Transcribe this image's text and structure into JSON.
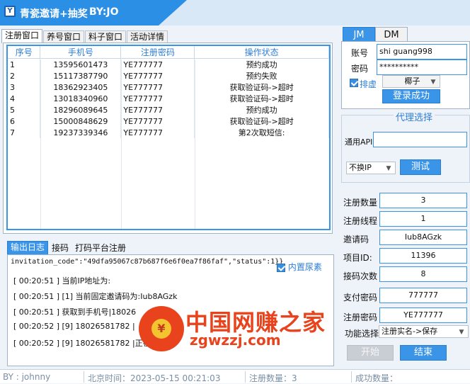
{
  "window": {
    "title": "青瓷邀请+抽奖",
    "subtitle": "BY:JO",
    "icon": "app-icon"
  },
  "main_tabs": [
    "注册窗口",
    "养号窗口",
    "料子窗口",
    "活动详情"
  ],
  "grid": {
    "headers": [
      "序号",
      "手机号",
      "注册密码",
      "操作状态"
    ],
    "rows": [
      [
        "1",
        "13595601473",
        "YE777777",
        "预约成功"
      ],
      [
        "2",
        "15117387790",
        "YE777777",
        "预约失败"
      ],
      [
        "3",
        "18362923405",
        "YE777777",
        "获取验证码->超时"
      ],
      [
        "4",
        "13018340960",
        "YE777777",
        "获取验证码->超时"
      ],
      [
        "5",
        "18296089645",
        "YE777777",
        "预约成功"
      ],
      [
        "6",
        "15000848629",
        "YE777777",
        "获取验证码->超时"
      ],
      [
        "7",
        "19237339346",
        "YE777777",
        "第2次取短信:"
      ]
    ]
  },
  "log_tabs": [
    "输出日志",
    "接码",
    "打码平台注册"
  ],
  "log": {
    "first_line": "invitation_code\":\"49dfa95067c87b687f6e6f0ea7f86faf\",\"status\":1}}",
    "builtin_checkbox": "内置尿素",
    "lines": [
      "[ 00:20:51 ] 当前IP地址为:",
      "[ 00:20:51 ] [1] 当前固定邀请码为:Iub8AGzk",
      "[ 00:20:51 ] 获取到手机号|18026",
      "[ 00:20:52 ] [9] 18026581782 |",
      "[ 00:20:52 ] [9] 18026581782 |正在"
    ]
  },
  "watermark": {
    "cn": "中国网赚之家",
    "url": "zgwzzj.com",
    "coin": "¥"
  },
  "right_tabs": [
    "JM",
    "DM"
  ],
  "account": {
    "user_label": "账号",
    "user_value": "shi guang998",
    "pass_label": "密码",
    "pass_value": "**********",
    "queue_label": "排虚",
    "queue_combo": "椰子",
    "login_button": "登录成功"
  },
  "proxy": {
    "group_title": "代理选择",
    "api_label": "通用API",
    "api_value": "",
    "ip_combo": "不换IP",
    "test_button": "测试"
  },
  "params": [
    {
      "label": "注册数量",
      "value": "3"
    },
    {
      "label": "注册线程",
      "value": "1"
    },
    {
      "label": "邀请码",
      "value": "Iub8AGzk"
    },
    {
      "label": "项目ID:",
      "value": "11396"
    },
    {
      "label": "接码次数",
      "value": "8"
    },
    {
      "label": "支付密码",
      "value": "777777"
    },
    {
      "label": "注册密码",
      "value": "YE777777"
    }
  ],
  "function_select": {
    "label": "功能选择",
    "value": "注册实名->保存"
  },
  "buttons": {
    "start": "开始",
    "end": "结束"
  },
  "status": {
    "by": "BY : johnny",
    "time": "北京时间：2023-05-15 00:21:03",
    "reg_count": "注册数量：3",
    "success": "成功数量："
  }
}
